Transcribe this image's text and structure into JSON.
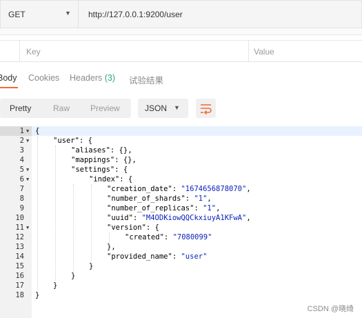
{
  "request": {
    "method": "GET",
    "url": "http://127.0.0.1:9200/user"
  },
  "params": {
    "key_placeholder": "Key",
    "value_placeholder": "Value"
  },
  "tabs": {
    "body": "Body",
    "cookies": "Cookies",
    "headers": "Headers",
    "headers_count": "(3)",
    "test_results": "试验结果"
  },
  "toolbar": {
    "pretty": "Pretty",
    "raw": "Raw",
    "preview": "Preview",
    "format": "JSON"
  },
  "code_lines": [
    {
      "n": "1",
      "fold": true,
      "indent": 0,
      "t": "{"
    },
    {
      "n": "2",
      "fold": true,
      "indent": 1,
      "t": "\"user\": {"
    },
    {
      "n": "3",
      "fold": false,
      "indent": 2,
      "t": "\"aliases\": {},"
    },
    {
      "n": "4",
      "fold": false,
      "indent": 2,
      "t": "\"mappings\": {},"
    },
    {
      "n": "5",
      "fold": true,
      "indent": 2,
      "t": "\"settings\": {"
    },
    {
      "n": "6",
      "fold": true,
      "indent": 3,
      "t": "\"index\": {"
    },
    {
      "n": "7",
      "fold": false,
      "indent": 4,
      "t": "\"creation_date\": \"1674656878070\","
    },
    {
      "n": "8",
      "fold": false,
      "indent": 4,
      "t": "\"number_of_shards\": \"1\","
    },
    {
      "n": "9",
      "fold": false,
      "indent": 4,
      "t": "\"number_of_replicas\": \"1\","
    },
    {
      "n": "10",
      "fold": false,
      "indent": 4,
      "t": "\"uuid\": \"M4ODKiowQQCkxiuyA1KFwA\","
    },
    {
      "n": "11",
      "fold": true,
      "indent": 4,
      "t": "\"version\": {"
    },
    {
      "n": "12",
      "fold": false,
      "indent": 5,
      "t": "\"created\": \"7080099\""
    },
    {
      "n": "13",
      "fold": false,
      "indent": 4,
      "t": "},"
    },
    {
      "n": "14",
      "fold": false,
      "indent": 4,
      "t": "\"provided_name\": \"user\""
    },
    {
      "n": "15",
      "fold": false,
      "indent": 3,
      "t": "}"
    },
    {
      "n": "16",
      "fold": false,
      "indent": 2,
      "t": "}"
    },
    {
      "n": "17",
      "fold": false,
      "indent": 1,
      "t": "}"
    },
    {
      "n": "18",
      "fold": false,
      "indent": 0,
      "t": "}"
    }
  ],
  "watermark": "CSDN @晓绮",
  "colors": {
    "accent": "#f26b3a",
    "count": "#2aa876",
    "string": "#0b22ba"
  }
}
